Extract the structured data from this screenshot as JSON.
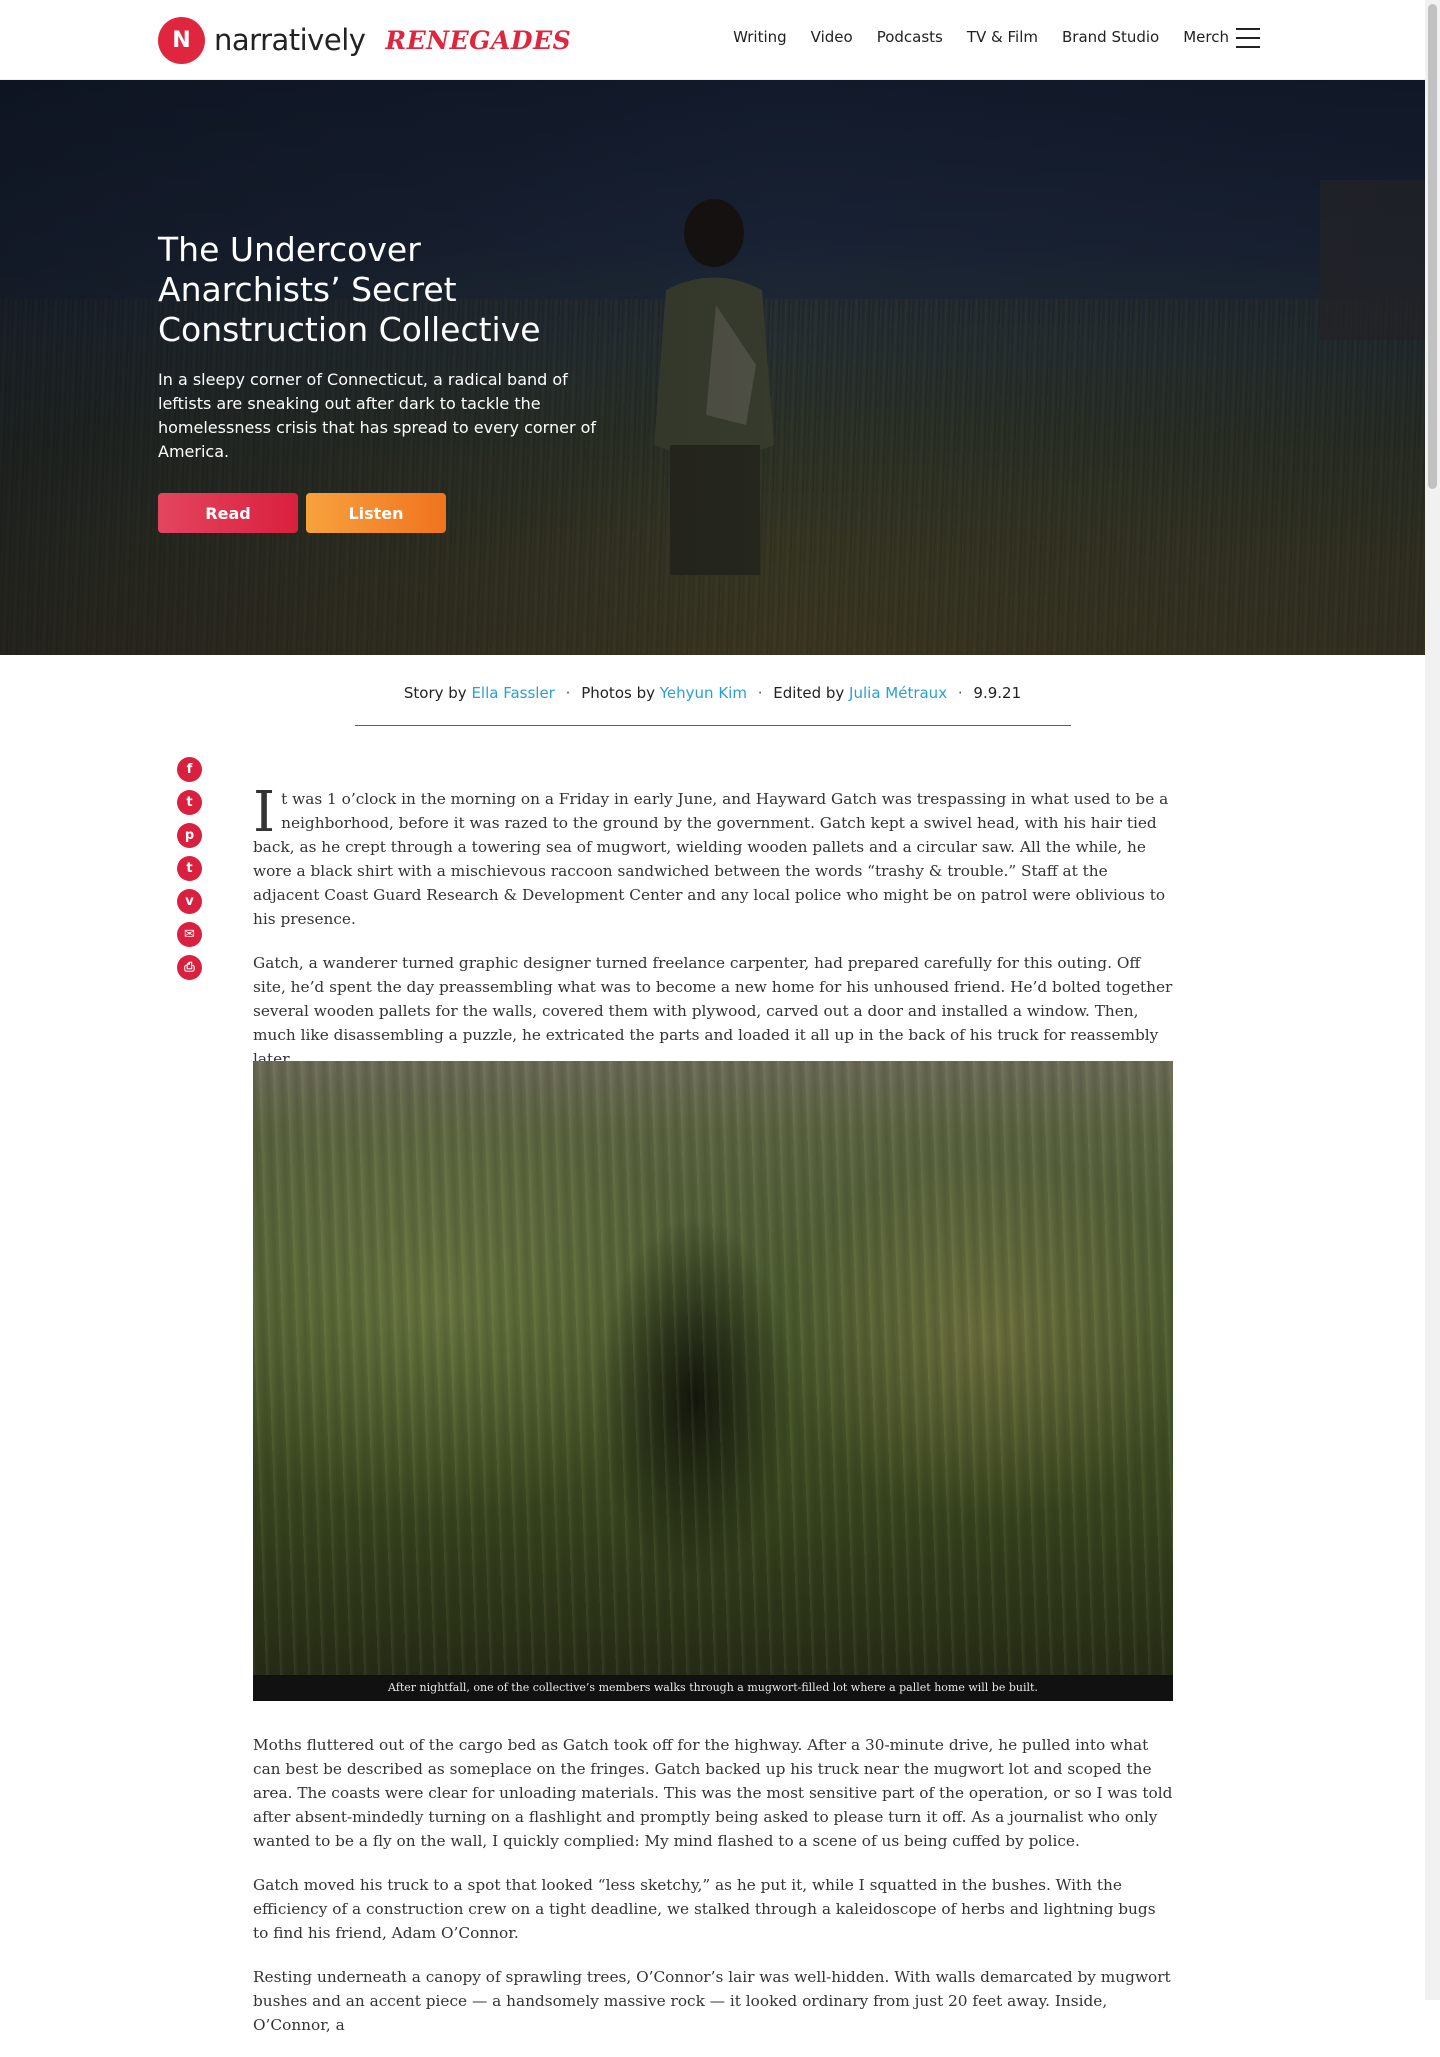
{
  "header": {
    "logo_mark": "N",
    "logo_word": "narratively",
    "logo_sub": "RENEGADES",
    "nav": [
      "Writing",
      "Video",
      "Podcasts",
      "TV & Film",
      "Brand Studio",
      "Merch"
    ]
  },
  "hero": {
    "title": "The Undercover Anarchists’ Secret Construction Collective",
    "dek": "In a sleepy corner of Connecticut, a radical band of leftists are sneaking out after dark to tackle the homelessness crisis that has spread to every corner of America.",
    "read_label": "Read",
    "listen_label": "Listen"
  },
  "byline": {
    "story_prefix": "Story by",
    "author": "Ella Fassler",
    "photos_prefix": "Photos by",
    "photographer": "Yehyun Kim",
    "edited_prefix": "Edited by",
    "editor": "Julia Métraux",
    "date": "9.9.21",
    "separator": "·"
  },
  "share": {
    "facebook": "f",
    "twitter": "t",
    "pinterest": "p",
    "tumblr": "t",
    "pocket": "v",
    "email": "✉",
    "print": "⎙"
  },
  "article": {
    "dropcap": "I",
    "p1": "t was 1 o’clock in the morning on a Friday in early June, and Hayward Gatch was trespassing in what used to be a neighborhood, before it was razed to the ground by the government. Gatch kept a swivel head, with his hair tied back, as he crept through a towering sea of mugwort, wielding wooden pallets and a circular saw. All the while, he wore a black shirt with a mischievous raccoon sandwiched between the words “trashy & trouble.” Staff at the adjacent Coast Guard Research & Development Center and any local police who might be on patrol were oblivious to his presence.",
    "p2": "Gatch, a wanderer turned graphic designer turned freelance carpenter, had prepared carefully for this outing. Off site, he’d spent the day preassembling what was to become a new home for his unhoused friend. He’d bolted together several wooden pallets for the walls, covered them with plywood, carved out a door and installed a window. Then, much like disassembling a puzzle, he extricated the parts and loaded it all up in the back of his truck for reassembly later.",
    "caption": "After nightfall, one of the collective’s members walks through a mugwort-filled lot where a pallet home will be built.",
    "p3": "Moths fluttered out of the cargo bed as Gatch took off for the highway. After a 30-minute drive, he pulled into what can best be described as someplace on the fringes. Gatch backed up his truck near the mugwort lot and scoped the area. The coasts were clear for unloading materials. This was the most sensitive part of the operation, or so I was told after absent-mindedly turning on a flashlight and promptly being asked to please turn it off. As a journalist who only wanted to be a fly on the wall, I quickly complied: My mind flashed to a scene of us being cuffed by police.",
    "p4": "Gatch moved his truck to a spot that looked “less sketchy,” as he put it, while I squatted in the bushes. With the efficiency of a construction crew on a tight deadline, we stalked through a kaleidoscope of herbs and lightning bugs to find his friend, Adam O’Connor.",
    "p5": "Resting underneath a canopy of sprawling trees, O’Connor’s lair was well-hidden. With walls demarcated by mugwort bushes and an accent piece — a handsomely massive rock — it looked ordinary from just 20 feet away. Inside, O’Connor, a"
  }
}
